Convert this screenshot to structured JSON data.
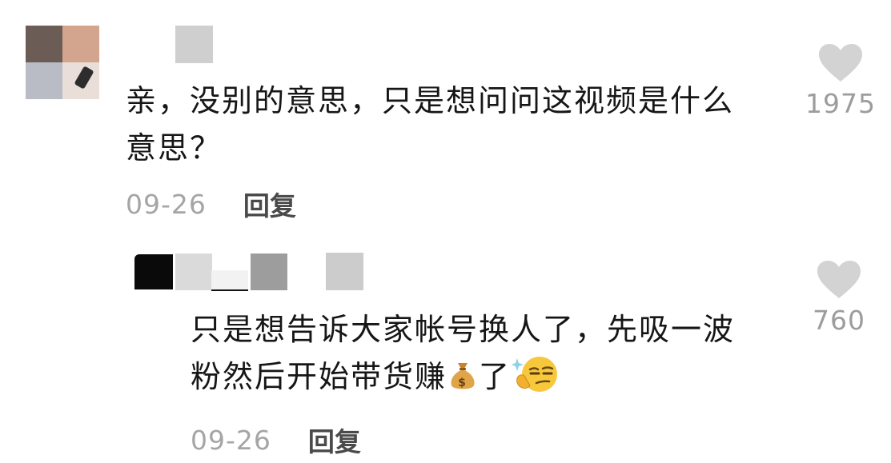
{
  "main_comment": {
    "text_line1": "亲，没别的意思，只是想问问这视频是什么",
    "text_line2": "意思？",
    "date": "09-26",
    "reply_label": "回复",
    "like_count": "1975"
  },
  "reply_comment": {
    "text_line1": "只是想告诉大家帐号换人了，先吸一波",
    "text_line2_before": "粉然后开始带货赚",
    "text_line2_after": "了",
    "date": "09-26",
    "reply_label": "回复",
    "like_count": "760"
  },
  "icons": {
    "like": "heart-icon",
    "money_bag": "money-bag-emoji",
    "smirk": "thinking-smirk-emoji"
  },
  "colors": {
    "like_heart": "#d3d3d3",
    "date_text": "#a5a5a5",
    "reply_text": "#4a4a4a"
  }
}
